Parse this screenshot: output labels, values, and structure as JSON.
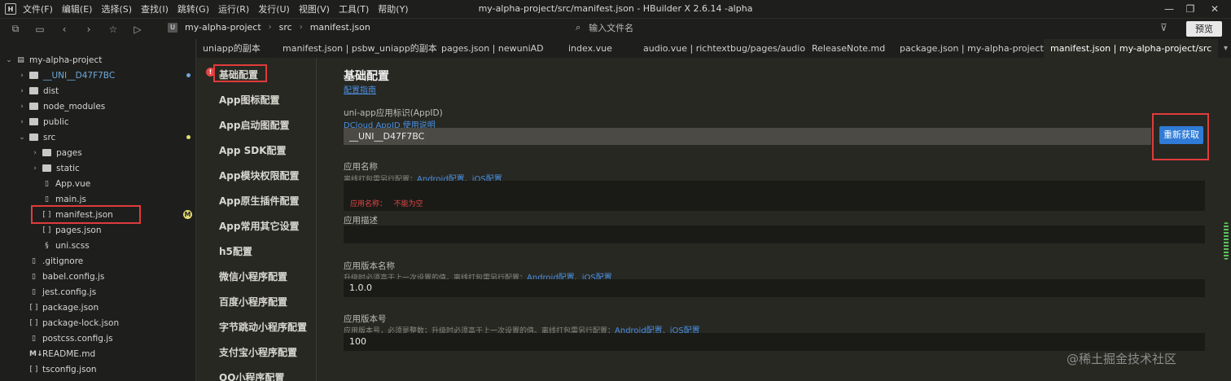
{
  "menubar": {
    "items": [
      "文件(F)",
      "编辑(E)",
      "选择(S)",
      "查找(I)",
      "跳转(G)",
      "运行(R)",
      "发行(U)",
      "视图(V)",
      "工具(T)",
      "帮助(Y)"
    ],
    "window_title": "my-alpha-project/src/manifest.json - HBuilder X 2.6.14 -alpha"
  },
  "toolbar": {
    "breadcrumbs": [
      "my-alpha-project",
      "src",
      "manifest.json"
    ],
    "file_search_placeholder": "输入文件名",
    "preview_label": "预览"
  },
  "sidebar": {
    "items": [
      {
        "label": "my-alpha-project",
        "kind": "folder-open"
      },
      {
        "label": "__UNI__D47F7BC",
        "kind": "folder",
        "status_color": "#6fa8dc"
      },
      {
        "label": "dist",
        "kind": "folder"
      },
      {
        "label": "node_modules",
        "kind": "folder"
      },
      {
        "label": "public",
        "kind": "folder"
      },
      {
        "label": "src",
        "kind": "folder-open",
        "status_color": "#e6db74"
      },
      {
        "label": "pages",
        "kind": "folder"
      },
      {
        "label": "static",
        "kind": "folder"
      },
      {
        "label": "App.vue",
        "kind": "file"
      },
      {
        "label": "main.js",
        "kind": "file"
      },
      {
        "label": "manifest.json",
        "kind": "json",
        "badge": "M"
      },
      {
        "label": "pages.json",
        "kind": "json"
      },
      {
        "label": "uni.scss",
        "kind": "file"
      },
      {
        "label": ".gitignore",
        "kind": "file"
      },
      {
        "label": "babel.config.js",
        "kind": "file"
      },
      {
        "label": "jest.config.js",
        "kind": "file"
      },
      {
        "label": "package.json",
        "kind": "json"
      },
      {
        "label": "package-lock.json",
        "kind": "json"
      },
      {
        "label": "postcss.config.js",
        "kind": "file"
      },
      {
        "label": "README.md",
        "kind": "md"
      },
      {
        "label": "tsconfig.json",
        "kind": "json"
      }
    ]
  },
  "tabs": [
    {
      "label": "uniapp的副本"
    },
    {
      "label": "manifest.json | psbw_uniapp的副本"
    },
    {
      "label": "pages.json | newuniAD"
    },
    {
      "label": "index.vue"
    },
    {
      "label": "audio.vue | richtextbug/pages/audio"
    },
    {
      "label": "ReleaseNote.md"
    },
    {
      "label": "package.json | my-alpha-project"
    },
    {
      "label": "manifest.json | my-alpha-project/src",
      "active": true
    }
  ],
  "nav": {
    "items": [
      "基础配置",
      "App图标配置",
      "App启动图配置",
      "App SDK配置",
      "App模块权限配置",
      "App原生插件配置",
      "App常用其它设置",
      "h5配置",
      "微信小程序配置",
      "百度小程序配置",
      "字节跳动小程序配置",
      "支付宝小程序配置",
      "QQ小程序配置"
    ]
  },
  "content": {
    "title": "基础配置",
    "guide_link": "配置指南",
    "appid": {
      "label": "uni-app应用标识(AppID)",
      "help_link": "DCloud AppID 使用说明",
      "value": "__UNI__D47F7BC",
      "refresh_label": "重新获取"
    },
    "app_name": {
      "label": "应用名称",
      "hint": "离线打包需另行配置：",
      "android_link": "Android配置",
      "sep": "、",
      "ios_link": "iOS配置",
      "value": "",
      "error_label": "应用名称：",
      "error_msg": "不能为空"
    },
    "app_desc": {
      "label": "应用描述",
      "value": ""
    },
    "version_name": {
      "label": "应用版本名称",
      "hint": "升级时必须高于上一次设置的值。离线打包需另行配置：",
      "android_link": "Android配置",
      "sep": "、",
      "ios_link": "iOS配置",
      "value": "1.0.0"
    },
    "version_code": {
      "label": "应用版本号",
      "hint": "应用版本号，必须是整数；升级时必须高于上一次设置的值。离线打包需另行配置：",
      "android_link": "Android配置",
      "sep": "、",
      "ios_link": "iOS配置",
      "value": "100"
    }
  },
  "watermark": "@稀土掘金技术社区",
  "colors": {
    "accent": "#2f7bd6",
    "highlight": "#e03b3b",
    "link": "#4a90e2"
  }
}
